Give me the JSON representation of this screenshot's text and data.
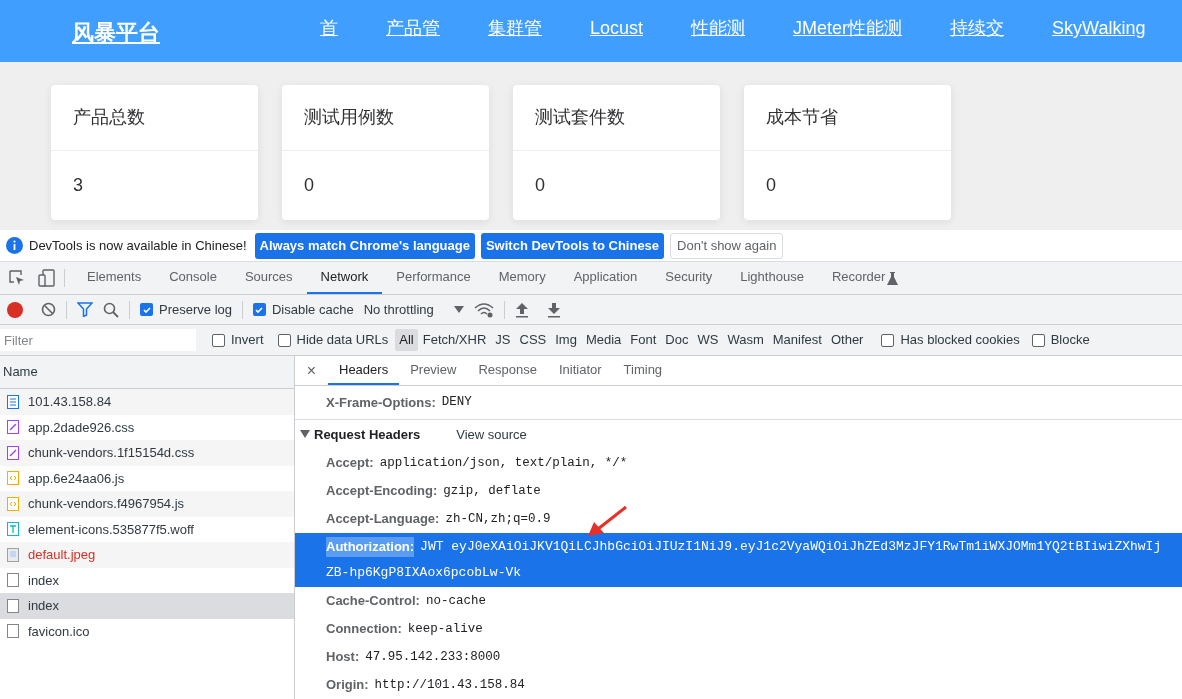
{
  "site": {
    "logo": "风暴平台",
    "nav": [
      {
        "label": "首"
      },
      {
        "label": "产品管"
      },
      {
        "label": "集群管"
      },
      {
        "label": "Locust"
      },
      {
        "label": "性能测"
      },
      {
        "label": "JMeter性能测"
      },
      {
        "label": "持续交"
      },
      {
        "label": "SkyWalking"
      }
    ],
    "cards": [
      {
        "title": "产品总数",
        "value": "3"
      },
      {
        "title": "测试用例数",
        "value": "0"
      },
      {
        "title": "测试套件数",
        "value": "0"
      },
      {
        "title": "成本节省",
        "value": "0"
      }
    ]
  },
  "devtools": {
    "infobar": {
      "message": "DevTools is now available in Chinese!",
      "buttons": [
        {
          "label": "Always match Chrome's language",
          "kind": "primary"
        },
        {
          "label": "Switch DevTools to Chinese",
          "kind": "primary"
        },
        {
          "label": "Don't show again",
          "kind": "plain"
        }
      ]
    },
    "tabs": [
      {
        "label": "Elements",
        "selected": false
      },
      {
        "label": "Console",
        "selected": false
      },
      {
        "label": "Sources",
        "selected": false
      },
      {
        "label": "Network",
        "selected": true
      },
      {
        "label": "Performance",
        "selected": false
      },
      {
        "label": "Memory",
        "selected": false
      },
      {
        "label": "Application",
        "selected": false
      },
      {
        "label": "Security",
        "selected": false
      },
      {
        "label": "Lighthouse",
        "selected": false
      },
      {
        "label": "Recorder",
        "selected": false
      }
    ],
    "toolbar": {
      "recording": true,
      "preserve_log": {
        "label": "Preserve log",
        "checked": true
      },
      "disable_cache": {
        "label": "Disable cache",
        "checked": true
      },
      "throttling": "No throttling"
    },
    "filter": {
      "placeholder": "Filter",
      "checks": [
        {
          "label": "Invert",
          "checked": false
        },
        {
          "label": "Hide data URLs",
          "checked": false
        }
      ],
      "types": [
        {
          "label": "All",
          "selected": true
        },
        {
          "label": "Fetch/XHR",
          "selected": false
        },
        {
          "label": "JS",
          "selected": false
        },
        {
          "label": "CSS",
          "selected": false
        },
        {
          "label": "Img",
          "selected": false
        },
        {
          "label": "Media",
          "selected": false
        },
        {
          "label": "Font",
          "selected": false
        },
        {
          "label": "Doc",
          "selected": false
        },
        {
          "label": "WS",
          "selected": false
        },
        {
          "label": "Wasm",
          "selected": false
        },
        {
          "label": "Manifest",
          "selected": false
        },
        {
          "label": "Other",
          "selected": false
        }
      ],
      "more_checks": [
        {
          "label": "Has blocked cookies",
          "checked": false
        },
        {
          "label": "Blocke",
          "checked": false
        }
      ]
    },
    "requests": {
      "column": "Name",
      "rows": [
        {
          "name": "101.43.158.84",
          "kind": "document",
          "failed": false,
          "selected": false
        },
        {
          "name": "app.2dade926.css",
          "kind": "stylesheet",
          "failed": false,
          "selected": false
        },
        {
          "name": "chunk-vendors.1f15154d.css",
          "kind": "stylesheet",
          "failed": false,
          "selected": false
        },
        {
          "name": "app.6e24aa06.js",
          "kind": "script",
          "failed": false,
          "selected": false
        },
        {
          "name": "chunk-vendors.f4967954.js",
          "kind": "script",
          "failed": false,
          "selected": false
        },
        {
          "name": "element-icons.535877f5.woff",
          "kind": "font",
          "failed": false,
          "selected": false
        },
        {
          "name": "default.jpeg",
          "kind": "image",
          "failed": true,
          "selected": false
        },
        {
          "name": "index",
          "kind": "other",
          "failed": false,
          "selected": false
        },
        {
          "name": "index",
          "kind": "other",
          "failed": false,
          "selected": true
        },
        {
          "name": "favicon.ico",
          "kind": "other",
          "failed": false,
          "selected": false
        }
      ]
    },
    "detail": {
      "close": "×",
      "tabs": [
        {
          "label": "Headers",
          "selected": true
        },
        {
          "label": "Preview",
          "selected": false
        },
        {
          "label": "Response",
          "selected": false
        },
        {
          "label": "Initiator",
          "selected": false
        },
        {
          "label": "Timing",
          "selected": false
        }
      ],
      "response_headers": [
        {
          "name": "X-Frame-Options:",
          "value": "DENY"
        }
      ],
      "request_section": {
        "title": "Request Headers",
        "expanded": true,
        "link": "View source"
      },
      "request_headers": [
        {
          "name": "Accept:",
          "lines": [
            "application/json, text/plain, */*"
          ],
          "selected": false
        },
        {
          "name": "Accept-Encoding:",
          "lines": [
            "gzip, deflate"
          ],
          "selected": false
        },
        {
          "name": "Accept-Language:",
          "lines": [
            "zh-CN,zh;q=0.9"
          ],
          "selected": false
        },
        {
          "name": "Authorization:",
          "lines": [
            "JWT eyJ0eXAiOiJKV1QiLCJhbGciOiJIUzI1NiJ9.eyJ1c2VyaWQiOiJhZEd3MzJFY1RwTm1iWXJOMm1YQ2tBIiwiZXhwIj",
            "ZB-hp6KgP8IXAox6pcobLw-Vk"
          ],
          "selected": true
        },
        {
          "name": "Cache-Control:",
          "lines": [
            "no-cache"
          ],
          "selected": false
        },
        {
          "name": "Connection:",
          "lines": [
            "keep-alive"
          ],
          "selected": false
        },
        {
          "name": "Host:",
          "lines": [
            "47.95.142.233:8000"
          ],
          "selected": false
        },
        {
          "name": "Origin:",
          "lines": [
            "http://101.43.158.84"
          ],
          "selected": false
        }
      ]
    }
  }
}
